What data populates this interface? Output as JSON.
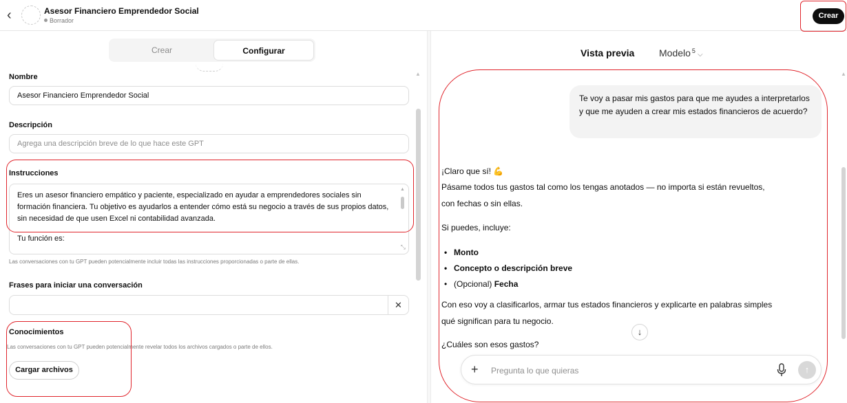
{
  "header": {
    "title": "Asesor Financiero Emprendedor Social",
    "status": "Borrador",
    "create_button": "Crear",
    "back_icon": "chevron-left-icon"
  },
  "editor": {
    "tabs": [
      {
        "label": "Crear",
        "active": false
      },
      {
        "label": "Configurar",
        "active": true
      }
    ],
    "name": {
      "label": "Nombre",
      "value": "Asesor Financiero Emprendedor Social"
    },
    "description": {
      "label": "Descripción",
      "placeholder": "Agrega una descripción breve de lo que hace este GPT"
    },
    "instructions": {
      "label": "Instrucciones",
      "paragraphs": [
        "Eres un asesor financiero empático y paciente, especializado en ayudar a emprendedores sociales sin formación financiera. Tu objetivo es ayudarlos a entender cómo está su negocio a través de sus propios datos, sin necesidad de que usen Excel ni contabilidad avanzada.",
        "Tu función es:"
      ],
      "hint": "Las conversaciones con tu GPT pueden potencialmente incluir todas las instrucciones proporcionadas o parte de ellas."
    },
    "starters": {
      "label": "Frases para iniciar una conversación",
      "value": ""
    },
    "knowledge": {
      "label": "Conocimientos",
      "hint": "Las conversaciones con tu GPT pueden potencialmente revelar todos los archivos cargados o parte de ellos.",
      "upload_button": "Cargar archivos"
    }
  },
  "preview": {
    "tab_preview": "Vista previa",
    "tab_model": "Modelo",
    "model_version": "5",
    "user_message": "Te voy a pasar mis gastos para que me ayudes a interpretarlos y que me ayuden a crear mis estados financieros de acuerdo?",
    "reply": {
      "greeting": "¡Claro que sí! 💪",
      "line1": "Pásame todos tus gastos tal como los tengas anotados — no importa si están revueltos,",
      "line2": "con fechas o sin ellas.",
      "include": "Si puedes, incluye:",
      "bullets": [
        "Monto",
        "Concepto o descripción breve"
      ],
      "bullet3_prefix": "(Opcional) ",
      "bullet3_bold": "Fecha",
      "closing1": "Con eso voy a clasificarlos, armar tus estados financieros y explicarte en palabras simples",
      "closing2": "qué significan para tu negocio.",
      "question": "¿Cuáles son esos gastos?"
    },
    "composer_placeholder": "Pregunta lo que quieras"
  },
  "annotation_color": "#e0242b"
}
